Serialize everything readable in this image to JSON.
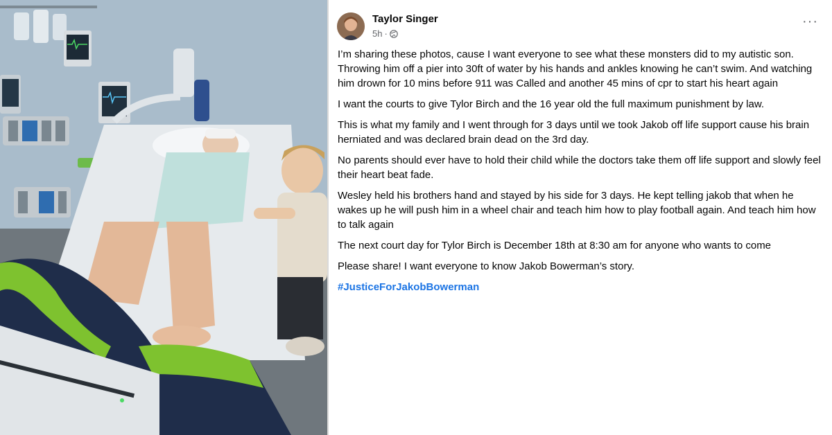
{
  "photo": {
    "label": "hospital-bed-photo"
  },
  "post": {
    "author": "Taylor Singer",
    "time": "5h",
    "separator": "·",
    "privacy_icon": "globe-icon",
    "more_icon": "more-options-icon",
    "more_label": "···",
    "paragraphs": [
      "I’m sharing these photos, cause I want everyone to see what these monsters did to my autistic son. Throwing him off a pier into 30ft of water by his hands and ankles knowing he can’t swim. And watching him drown for 10 mins before 911 was Called  and another 45 mins of cpr to start his heart again",
      "I want the courts to give Tylor Birch and the 16 year old the full maximum punishment by law.",
      "This is what my family and I went through for 3 days until we took Jakob off life support cause his brain herniated and was declared brain dead on the 3rd day.",
      "No parents should ever have to hold their child while the doctors take them off life support and slowly feel their heart beat fade.",
      "Wesley held  his brothers hand and stayed  by his side for 3 days. He kept telling jakob that when he wakes up he will push him in a wheel chair and teach him how to play football again. And teach him how to talk again",
      "The next court day for Tylor Birch is December 18th at 8:30 am for anyone who wants to come",
      "Please share! I want everyone to know Jakob Bowerman’s story."
    ],
    "hashtag": "#JusticeForJakobBowerman",
    "colors": {
      "text": "#050505",
      "secondary": "#65676b",
      "link": "#1b74e4"
    }
  }
}
